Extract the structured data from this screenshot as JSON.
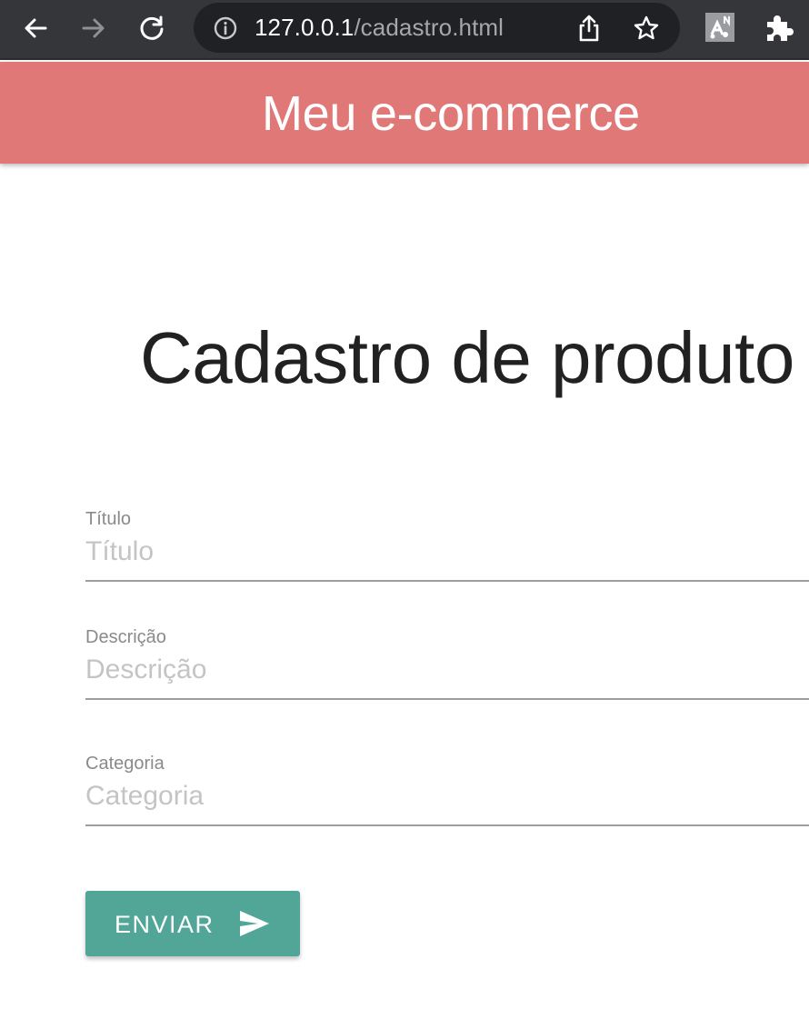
{
  "browser": {
    "url_host": "127.0.0.1",
    "url_path": "/cadastro.html",
    "icons": [
      "back-icon",
      "forward-icon",
      "reload-icon",
      "info-icon",
      "share-icon",
      "star-icon",
      "extension-icon",
      "puzzle-icon"
    ]
  },
  "header": {
    "title": "Meu e-commerce",
    "background": "#e07878"
  },
  "main": {
    "title": "Cadastro de produto",
    "fields": [
      {
        "label": "Título",
        "placeholder": "Título",
        "value": ""
      },
      {
        "label": "Descrição",
        "placeholder": "Descrição",
        "value": ""
      },
      {
        "label": "Categoria",
        "placeholder": "Categoria",
        "value": ""
      }
    ],
    "submit": {
      "label": "ENVIAR",
      "icon": "send-icon",
      "color": "#51a697"
    }
  }
}
